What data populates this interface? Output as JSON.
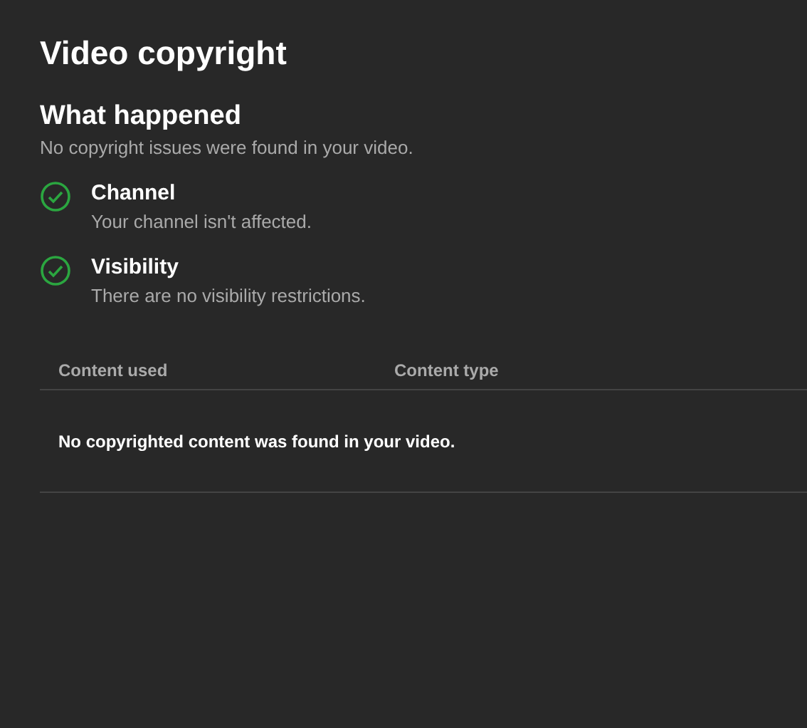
{
  "title": "Video copyright",
  "section": {
    "heading": "What happened",
    "summary": "No copyright issues were found in your video."
  },
  "checks": [
    {
      "kind": "passed",
      "title": "Channel",
      "detail": "Your channel isn't affected."
    },
    {
      "kind": "passed",
      "title": "Visibility",
      "detail": "There are no visibility restrictions."
    }
  ],
  "table": {
    "columns": [
      "Content used",
      "Content type"
    ],
    "empty_message": "No copyrighted content was found in your video."
  }
}
